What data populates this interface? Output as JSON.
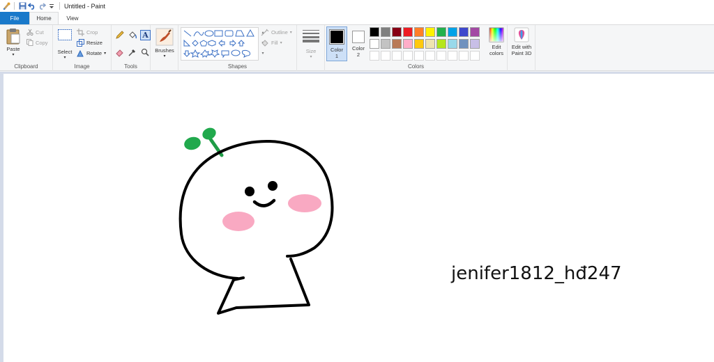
{
  "window": {
    "title": "Untitled - Paint"
  },
  "tabs": [
    {
      "label": "File"
    },
    {
      "label": "Home"
    },
    {
      "label": "View"
    }
  ],
  "clipboard": {
    "paste": "Paste",
    "cut": "Cut",
    "copy": "Copy",
    "group": "Clipboard"
  },
  "image": {
    "select": "Select",
    "crop": "Crop",
    "resize": "Resize",
    "rotate": "Rotate",
    "group": "Image"
  },
  "tools": {
    "group": "Tools"
  },
  "brushes": {
    "label": "Brushes"
  },
  "shapes": {
    "outline": "Outline",
    "fill": "Fill",
    "group": "Shapes"
  },
  "size": {
    "label": "Size"
  },
  "colors": {
    "color1_label": "Color",
    "color1_num": "1",
    "color2_label": "Color",
    "color2_num": "2",
    "group": "Colors",
    "edit_label1": "Edit",
    "edit_label2": "colors",
    "color1": "#000000",
    "color2": "#ffffff",
    "palette_row1": [
      "#000000",
      "#7f7f7f",
      "#880015",
      "#ed1c24",
      "#ff7f27",
      "#fff200",
      "#22b14c",
      "#00a2e8",
      "#3f48cc",
      "#a349a4"
    ],
    "palette_row2": [
      "#ffffff",
      "#c3c3c3",
      "#b97a57",
      "#ffaec9",
      "#ffc90e",
      "#efe4b0",
      "#b5e61d",
      "#99d9ea",
      "#7092be",
      "#c8bfe7"
    ]
  },
  "paint3d": {
    "label1": "Edit with",
    "label2": "Paint 3D"
  },
  "canvas": {
    "signature": "jenifer1812_hđ247"
  }
}
